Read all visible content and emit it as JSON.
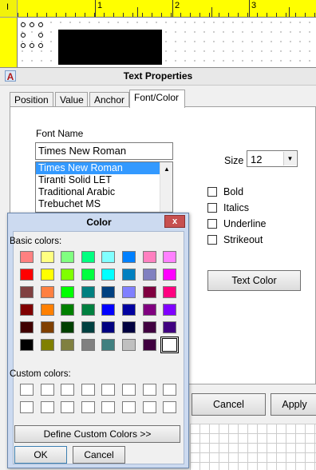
{
  "ruler": {
    "corner_label": "I",
    "numbers": [
      "1",
      "2",
      "3"
    ]
  },
  "dialog": {
    "title": "Text Properties",
    "tabs": [
      "Position",
      "Value",
      "Anchor",
      "Font/Color"
    ],
    "active_tab": "Font/Color",
    "font_name_label": "Font Name",
    "font_name_value": "Times New Roman",
    "font_list": [
      "Times New Roman",
      "Tiranti Solid LET",
      "Traditional Arabic",
      "Trebuchet MS"
    ],
    "selected_font": "Times New Roman",
    "size_label": "Size",
    "size_value": "12",
    "checkboxes": [
      "Bold",
      "Italics",
      "Underline",
      "Strikeout"
    ],
    "text_color_button": "Text Color",
    "cancel_button": "Cancel",
    "apply_button": "Apply"
  },
  "color_dialog": {
    "title": "Color",
    "close_label": "x",
    "basic_colors_label": "Basic colors:",
    "custom_colors_label": "Custom colors:",
    "define_button": "Define Custom Colors >>",
    "ok_button": "OK",
    "cancel_button": "Cancel",
    "basic_colors": [
      [
        "#ff8080",
        "#ffff80",
        "#80ff80",
        "#00ff80",
        "#80ffff",
        "#0080ff",
        "#ff80c0",
        "#ff80ff"
      ],
      [
        "#ff0000",
        "#ffff00",
        "#80ff00",
        "#00ff40",
        "#00ffff",
        "#0080c0",
        "#8080c0",
        "#ff00ff"
      ],
      [
        "#804040",
        "#ff8040",
        "#00ff00",
        "#008080",
        "#004080",
        "#8080ff",
        "#800040",
        "#ff0080"
      ],
      [
        "#800000",
        "#ff8000",
        "#008000",
        "#008040",
        "#0000ff",
        "#0000a0",
        "#800080",
        "#8000ff"
      ],
      [
        "#400000",
        "#804000",
        "#004000",
        "#004040",
        "#000080",
        "#000040",
        "#400040",
        "#400080"
      ],
      [
        "#000000",
        "#808000",
        "#808040",
        "#808080",
        "#408080",
        "#c0c0c0",
        "#400040",
        "#ffffff"
      ]
    ],
    "selected_color": "#ffffff",
    "custom_slots": 16
  }
}
